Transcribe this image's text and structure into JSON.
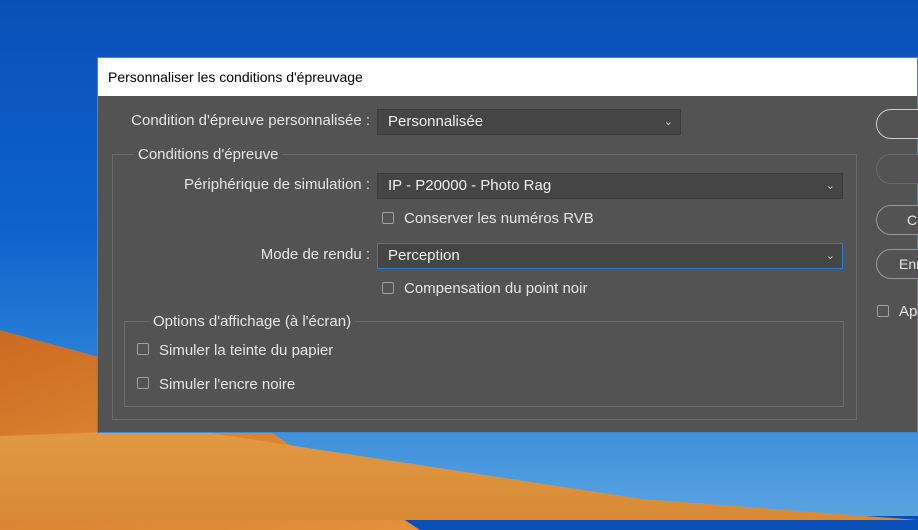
{
  "window": {
    "title": "Personnaliser les conditions d'épreuvage"
  },
  "custom": {
    "label": "Condition d'épreuve personnalisée :",
    "value": "Personnalisée"
  },
  "proof": {
    "legend": "Conditions d'épreuve",
    "device_label": "Périphérique de simulation :",
    "device_value": "IP - P20000 - Photo Rag",
    "keep_rgb_label": "Conserver les numéros RVB",
    "intent_label": "Mode de rendu :",
    "intent_value": "Perception",
    "bpc_label": "Compensation du point noir"
  },
  "display": {
    "legend": "Options d'affichage (à l'écran)",
    "paper_label": "Simuler la teinte du papier",
    "ink_label": "Simuler l'encre noire"
  },
  "side": {
    "btn3": "C",
    "btn4": "Enr",
    "preview_label": "Ap"
  }
}
